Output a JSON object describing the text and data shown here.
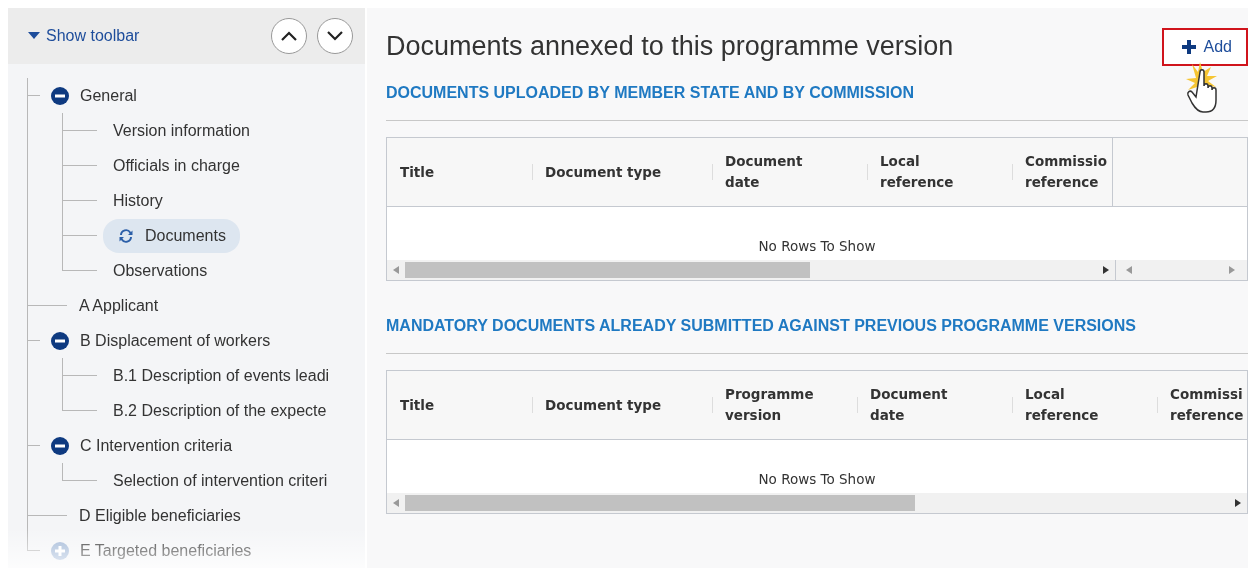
{
  "sidebar": {
    "toolbar_toggle": "Show toolbar",
    "tree": [
      {
        "label": "General",
        "expanded": true,
        "selected": false,
        "children": [
          {
            "label": "Version information",
            "selected": false
          },
          {
            "label": "Officials in charge",
            "selected": false
          },
          {
            "label": "History",
            "selected": false
          },
          {
            "label": "Documents",
            "selected": true
          },
          {
            "label": "Observations",
            "selected": false
          }
        ]
      },
      {
        "label": "A Applicant",
        "selected": false
      },
      {
        "label": "B Displacement of workers",
        "expanded": true,
        "selected": false,
        "children": [
          {
            "label": "B.1 Description of events leadi",
            "selected": false
          },
          {
            "label": "B.2 Description of the expecte",
            "selected": false
          }
        ]
      },
      {
        "label": "C Intervention criteria",
        "expanded": true,
        "selected": false,
        "children": [
          {
            "label": "Selection of intervention criteri",
            "selected": false
          }
        ]
      },
      {
        "label": "D Eligible beneficiaries",
        "selected": false
      },
      {
        "label": "E Targeted beneficiaries",
        "expanded": false,
        "selected": false
      }
    ]
  },
  "main": {
    "title": "Documents annexed to this programme version",
    "add_button": "Add",
    "sections": [
      {
        "heading": "DOCUMENTS UPLOADED BY MEMBER STATE AND BY COMMISSION",
        "has_pinned_column": true,
        "empty_message": "No Rows To Show",
        "columns": [
          {
            "label": "Title"
          },
          {
            "label": "Document type"
          },
          {
            "label": "Document date"
          },
          {
            "label": "Local reference"
          },
          {
            "label": "Commissio reference"
          }
        ]
      },
      {
        "heading": "MANDATORY DOCUMENTS ALREADY SUBMITTED AGAINST PREVIOUS PROGRAMME VERSIONS",
        "has_pinned_column": false,
        "empty_message": "No Rows To Show",
        "columns": [
          {
            "label": "Title"
          },
          {
            "label": "Document type"
          },
          {
            "label": "Programme version"
          },
          {
            "label": "Document date"
          },
          {
            "label": "Local reference"
          },
          {
            "label": "Commissi reference"
          }
        ]
      }
    ]
  }
}
